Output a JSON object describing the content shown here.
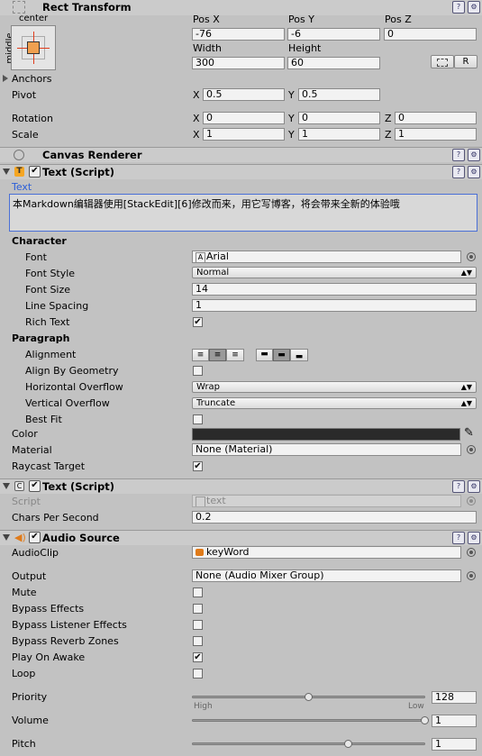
{
  "rect_transform": {
    "title": "Rect Transform",
    "anchor_h": "center",
    "anchor_v": "middle",
    "pos_x_label": "Pos X",
    "pos_y_label": "Pos Y",
    "pos_z_label": "Pos Z",
    "pos_x": "-76",
    "pos_y": "-6",
    "pos_z": "0",
    "width_label": "Width",
    "height_label": "Height",
    "width": "300",
    "height": "60",
    "blueprint_btn": "",
    "raw_btn": "R",
    "anchors_label": "Anchors",
    "pivot_label": "Pivot",
    "pivot_x": "0.5",
    "pivot_y": "0.5",
    "rotation_label": "Rotation",
    "rot_x": "0",
    "rot_y": "0",
    "rot_z": "0",
    "scale_label": "Scale",
    "scale_x": "1",
    "scale_y": "1",
    "scale_z": "1",
    "x": "X",
    "y": "Y",
    "z": "Z"
  },
  "canvas_renderer": {
    "title": "Canvas Renderer"
  },
  "text_script": {
    "title": "Text (Script)",
    "text_label": "Text",
    "text_value": "本Markdown编辑器使用[StackEdit][6]修改而来，用它写博客，将会带来全新的体验哦",
    "character_label": "Character",
    "font_label": "Font",
    "font_value": "Arial",
    "font_style_label": "Font Style",
    "font_style_value": "Normal",
    "font_size_label": "Font Size",
    "font_size_value": "14",
    "line_spacing_label": "Line Spacing",
    "line_spacing_value": "1",
    "rich_text_label": "Rich Text",
    "rich_text": true,
    "paragraph_label": "Paragraph",
    "alignment_label": "Alignment",
    "align_by_geometry_label": "Align By Geometry",
    "align_by_geometry": false,
    "horizontal_overflow_label": "Horizontal Overflow",
    "horizontal_overflow_value": "Wrap",
    "vertical_overflow_label": "Vertical Overflow",
    "vertical_overflow_value": "Truncate",
    "best_fit_label": "Best Fit",
    "best_fit": false,
    "color_label": "Color",
    "color_value": "#2a2a2a",
    "material_label": "Material",
    "material_value": "None (Material)",
    "raycast_label": "Raycast Target",
    "raycast": true
  },
  "typewriter_script": {
    "title": "Text (Script)",
    "script_label": "Script",
    "script_value": "text",
    "chars_label": "Chars Per Second",
    "chars_value": "0.2"
  },
  "audio_source": {
    "title": "Audio Source",
    "clip_label": "AudioClip",
    "clip_value": "keyWord",
    "output_label": "Output",
    "output_value": "None (Audio Mixer Group)",
    "mute_label": "Mute",
    "mute": false,
    "bypass_effects_label": "Bypass Effects",
    "bypass_effects": false,
    "bypass_listener_label": "Bypass Listener Effects",
    "bypass_listener": false,
    "bypass_reverb_label": "Bypass Reverb Zones",
    "bypass_reverb": false,
    "play_on_awake_label": "Play On Awake",
    "play_on_awake": true,
    "loop_label": "Loop",
    "loop": false,
    "priority_label": "Priority",
    "priority_value": "128",
    "priority_fraction": 0.5,
    "priority_high": "High",
    "priority_low": "Low",
    "volume_label": "Volume",
    "volume_value": "1",
    "volume_fraction": 1.0,
    "pitch_label": "Pitch",
    "pitch_value": "1",
    "pitch_fraction": 0.67
  },
  "icons": [
    "settings-icon",
    "help-icon",
    "rect-transform-icon",
    "canvas-renderer-icon",
    "text-icon",
    "script-icon",
    "audio-source-icon",
    "object-picker-icon",
    "eyedropper-icon"
  ]
}
